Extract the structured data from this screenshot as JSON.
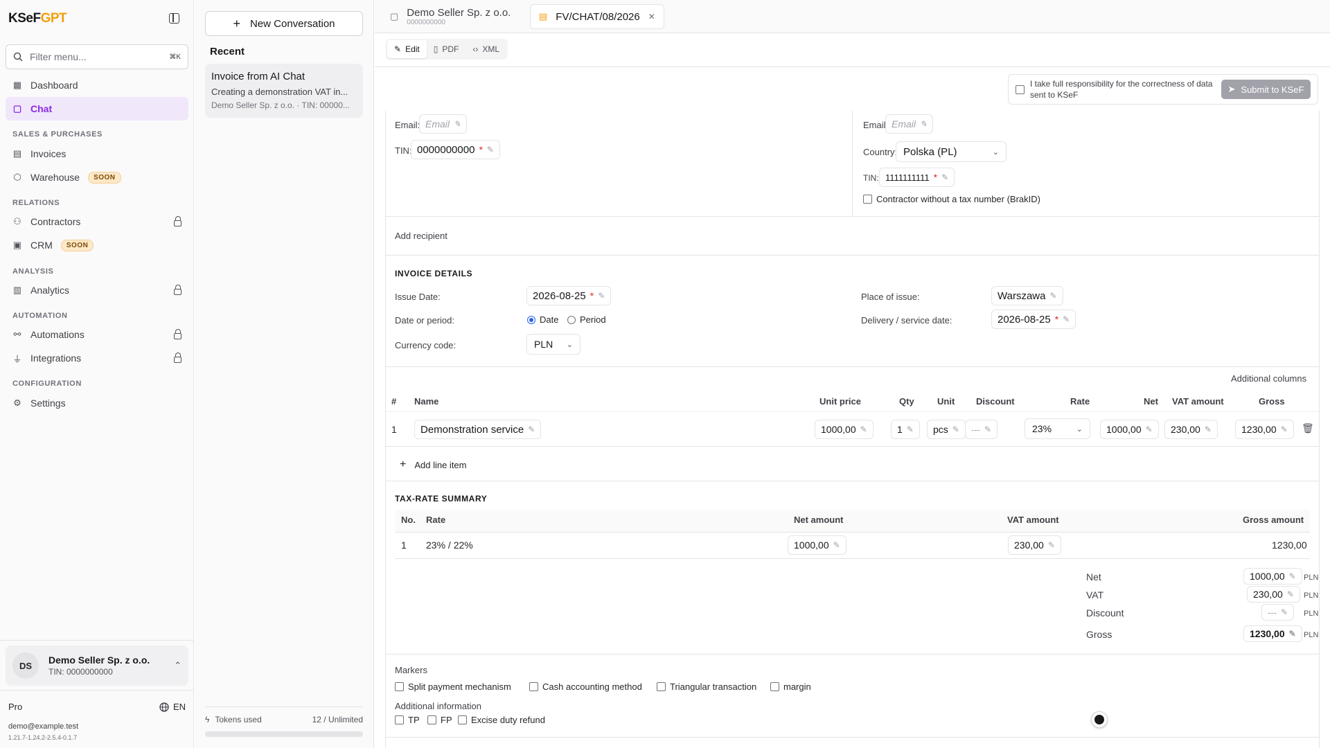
{
  "sidebar": {
    "logo_main": "KSeF",
    "logo_accent": "GPT",
    "filter_placeholder": "Filter menu...",
    "filter_shortcut": "⌘K",
    "items": {
      "dashboard": "Dashboard",
      "chat": "Chat",
      "invoices": "Invoices",
      "warehouse": "Warehouse",
      "contractors": "Contractors",
      "crm": "CRM",
      "analytics": "Analytics",
      "automations": "Automations",
      "integrations": "Integrations",
      "settings": "Settings"
    },
    "badge_soon": "SOON",
    "sections": {
      "sales": "SALES & PURCHASES",
      "relations": "RELATIONS",
      "analysis": "ANALYSIS",
      "automation": "AUTOMATION",
      "configuration": "CONFIGURATION"
    },
    "account": {
      "initials": "DS",
      "name": "Demo Seller Sp. z o.o.",
      "tin": "TIN: 0000000000"
    },
    "plan": "Pro",
    "language": "EN",
    "email": "demo@example.test",
    "version": "1.21.7-1.24.2-2.5.4-0.1.7"
  },
  "conversations": {
    "new_label": "New Conversation",
    "recent_label": "Recent",
    "items": [
      {
        "title": "Invoice from AI Chat",
        "snippet": "Creating a demonstration VAT in...",
        "meta": "Demo Seller Sp. z o.o. · TIN: 00000..."
      }
    ],
    "tokens_label": "Tokens used",
    "tokens_value": "12 / Unlimited",
    "tokens_fraction": 0
  },
  "tabs": [
    {
      "title": "Demo Seller Sp. z o.o.",
      "sub": "0000000000"
    },
    {
      "title": "FV/CHAT/08/2026"
    }
  ],
  "view_tabs": {
    "edit": "Edit",
    "pdf": "PDF",
    "xml": "XML"
  },
  "submit": {
    "consent": "I take full responsibility for the correctness of data sent to KSeF",
    "button": "Submit to KSeF"
  },
  "seller": {
    "email_label": "Email:",
    "email_placeholder": "Email",
    "tin_label": "TIN:",
    "tin_value": "0000000000"
  },
  "buyer": {
    "email_label": "Email:",
    "email_placeholder": "Email",
    "country_label": "Country:",
    "country_value": "Polska (PL)",
    "tin_label": "TIN:",
    "tin_value": "1111111111",
    "no_tax_label": "Contractor without a tax number (BrakID)"
  },
  "add_recipient": "Add recipient",
  "details": {
    "title": "INVOICE DETAILS",
    "issue_date_label": "Issue Date:",
    "issue_date": "2026-08-25",
    "date_or_period_label": "Date or period:",
    "opt_date": "Date",
    "opt_period": "Period",
    "currency_label": "Currency code:",
    "currency": "PLN",
    "place_label": "Place of issue:",
    "place": "Warszawa",
    "delivery_label": "Delivery / service date:",
    "delivery": "2026-08-25"
  },
  "additional_columns": "Additional columns",
  "items_table": {
    "headers": {
      "num": "#",
      "name": "Name",
      "unit_price": "Unit price",
      "qty": "Qty",
      "unit": "Unit",
      "discount": "Discount",
      "rate": "Rate",
      "net": "Net",
      "vat": "VAT amount",
      "gross": "Gross"
    },
    "rows": [
      {
        "num": "1",
        "name": "Demonstration service",
        "unit_price": "1000,00",
        "qty": "1",
        "unit": "pcs",
        "discount": "---",
        "rate": "23%",
        "net": "1000,00",
        "vat": "230,00",
        "gross": "1230,00"
      }
    ],
    "add_line": "Add line item"
  },
  "summary": {
    "title": "TAX-RATE SUMMARY",
    "headers": {
      "no": "No.",
      "rate": "Rate",
      "net": "Net amount",
      "vat": "VAT amount",
      "gross": "Gross amount"
    },
    "rows": [
      {
        "no": "1",
        "rate": "23% / 22%",
        "net": "1000,00",
        "vat": "230,00",
        "gross": "1230,00"
      }
    ]
  },
  "totals": {
    "net_label": "Net",
    "net": "1000,00",
    "vat_label": "VAT",
    "vat": "230,00",
    "discount_label": "Discount",
    "discount": "---",
    "gross_label": "Gross",
    "gross": "1230,00",
    "currency": "PLN"
  },
  "markers": {
    "title": "Markers",
    "split": "Split payment mechanism",
    "cash": "Cash accounting method",
    "triangular": "Triangular transaction",
    "margin": "margin",
    "additional_title": "Additional information",
    "tp": "TP",
    "fp": "FP",
    "excise": "Excise duty refund"
  }
}
